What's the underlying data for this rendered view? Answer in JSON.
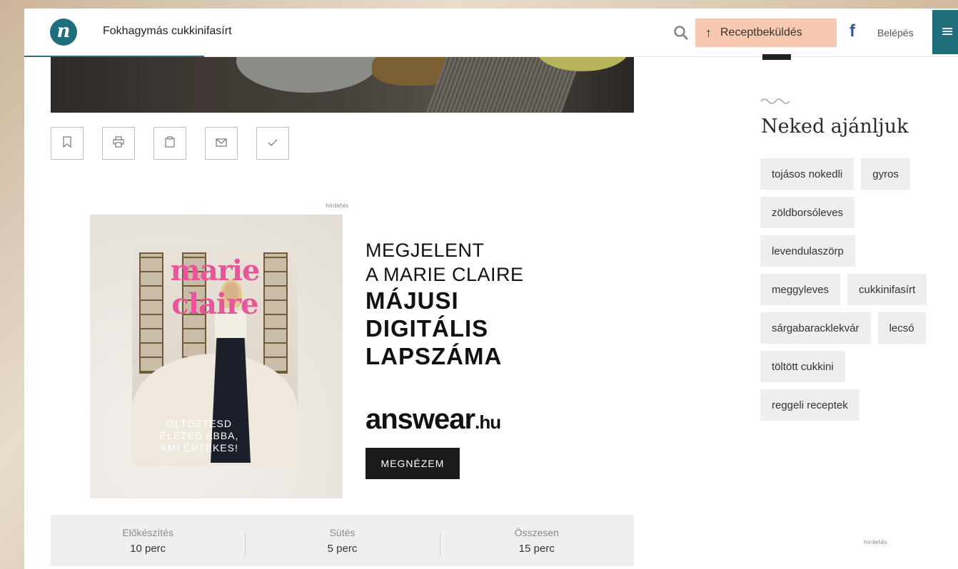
{
  "header": {
    "logo_letter": "n",
    "title": "Fokhagymás cukkinifasírt",
    "submit_label": "Receptbeküldés",
    "facebook_letter": "f",
    "login_label": "Belépés",
    "menu_icon": "≡"
  },
  "actions": [
    {
      "icon": "bookmark-icon",
      "glyph": "⎕"
    },
    {
      "icon": "print-icon",
      "glyph": "⎙"
    },
    {
      "icon": "clipboard-icon",
      "glyph": "⎗"
    },
    {
      "icon": "mail-icon",
      "glyph": "✉"
    },
    {
      "icon": "check-icon",
      "glyph": "✓"
    }
  ],
  "ad": {
    "label": "hirdetés",
    "magazine_brand": "marie claire",
    "cover_text": "ÖLTÖZTESD ÉLETED ABBA, AMI ÉRTÉKES!",
    "lines_light": [
      "MEGJELENT",
      "A MARIE CLAIRE"
    ],
    "lines_bold": [
      "MÁJUSI",
      "DIGITÁLIS",
      "LAPSZÁMA"
    ],
    "brand_main": "answear",
    "brand_suffix": ".hu",
    "cta": "MEGNÉZEM"
  },
  "times": [
    {
      "label": "Előkészítés",
      "value": "10 perc"
    },
    {
      "label": "Sütés",
      "value": "5 perc"
    },
    {
      "label": "Összesen",
      "value": "15 perc"
    }
  ],
  "sidebar": {
    "title": "Neked ajánljuk",
    "tags": [
      [
        "tojásos nokedli",
        "gyros"
      ],
      [
        "zöldborsóleves"
      ],
      [
        "levendulaszörp"
      ],
      [
        "meggyleves",
        "cukkinifasírt"
      ],
      [
        "sárgabaracklekvár",
        "lecsó"
      ],
      [
        "töltött cukkini"
      ],
      [
        "reggeli receptek"
      ]
    ],
    "ad_label": "hirdetés"
  },
  "colors": {
    "brand_teal": "#1e6f7b",
    "submit_bg": "#f8c9b0",
    "facebook": "#3b5998"
  }
}
